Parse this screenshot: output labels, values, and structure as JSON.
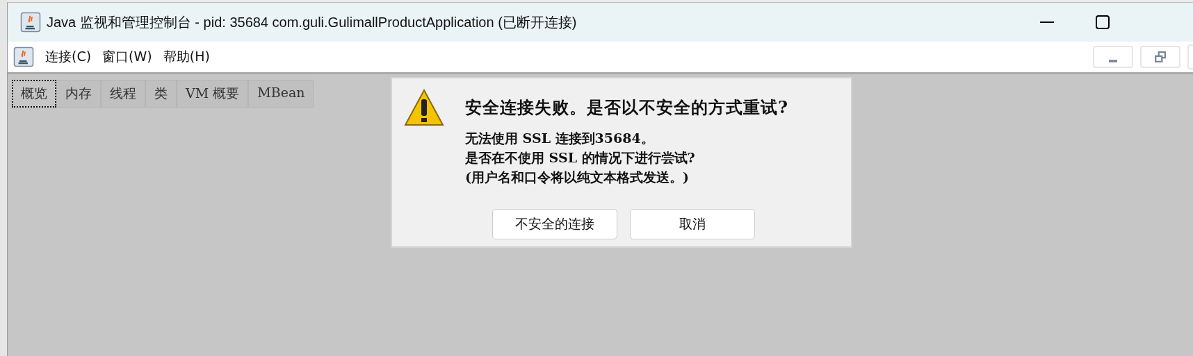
{
  "window": {
    "title": "Java 监视和管理控制台 - pid: 35684 com.guli.GulimallProductApplication (已断开连接)"
  },
  "menu": [
    "连接(C)",
    "窗口(W)",
    "帮助(H)"
  ],
  "tabs": [
    {
      "label": "概览",
      "selected": true
    },
    {
      "label": "内存",
      "selected": false
    },
    {
      "label": "线程",
      "selected": false
    },
    {
      "label": "类",
      "selected": false
    },
    {
      "label": "VM 概要",
      "selected": false
    },
    {
      "label": "MBean",
      "selected": false
    }
  ],
  "dialog": {
    "heading": "安全连接失败。是否以不安全的方式重试?",
    "lines": [
      "无法使用 SSL 连接到35684。",
      "是否在不使用 SSL 的情况下进行尝试?",
      "(用户名和口令将以纯文本格式发送。)"
    ],
    "buttons": [
      "不安全的连接",
      "取消"
    ]
  }
}
